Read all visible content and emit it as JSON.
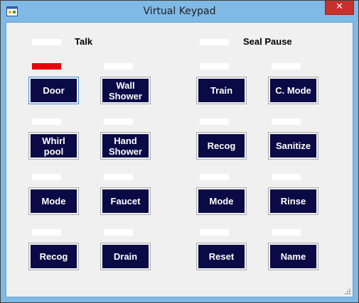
{
  "window": {
    "title": "Virtual Keypad",
    "close_glyph": "✕",
    "app_icon": "window-app-icon",
    "colors": {
      "frame": "#7fb9e6",
      "close": "#c7302b",
      "client_bg": "#f0f0f0",
      "key_face": "#0a0a46",
      "indicator_off": "#ffffff",
      "indicator_on": "#e8000b"
    }
  },
  "labels": {
    "talk": "Talk",
    "seal_pause": "Seal Pause"
  },
  "indicators": {
    "talk": "off",
    "talk_status": "on"
  },
  "keys": {
    "door": "Door",
    "wall_shower": "Wall\nShower",
    "train": "Train",
    "c_mode": "C. Mode",
    "whirlpool": "Whirl\npool",
    "hand_shower": "Hand\nShower",
    "recog_right": "Recog",
    "sanitize": "Sanitize",
    "mode_left": "Mode",
    "faucet": "Faucet",
    "mode_right": "Mode",
    "rinse": "Rinse",
    "recog_left": "Recog",
    "drain": "Drain",
    "reset": "Reset",
    "name": "Name"
  }
}
